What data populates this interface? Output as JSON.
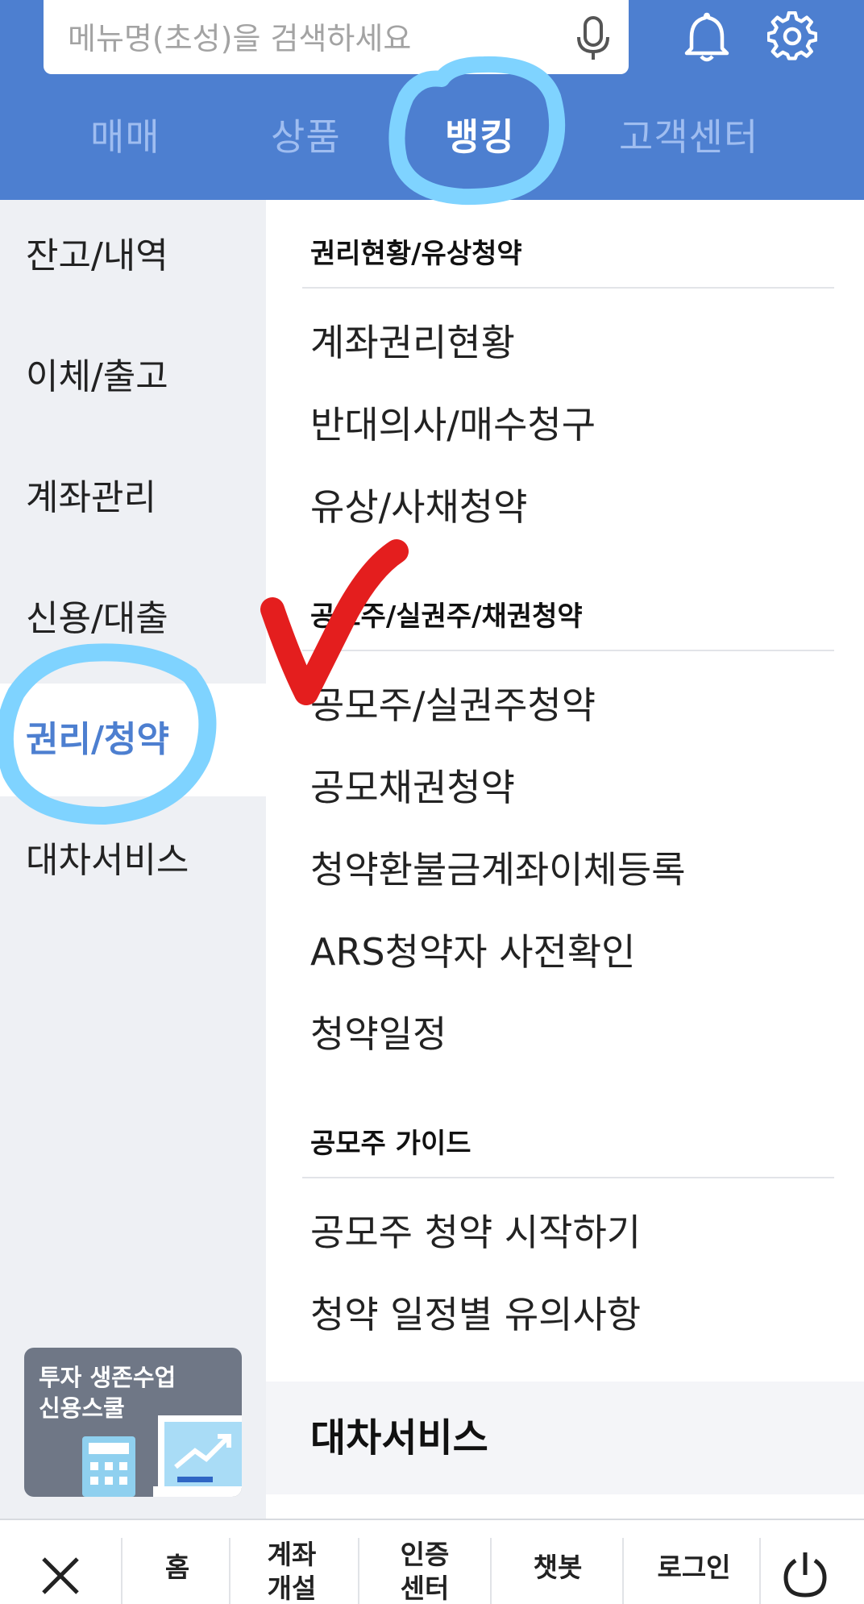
{
  "search": {
    "placeholder": "메뉴명(초성)을 검색하세요"
  },
  "header": {
    "icons": [
      "mic-icon",
      "bell-icon",
      "gear-icon"
    ]
  },
  "tabs": [
    {
      "label": "매매",
      "active": false
    },
    {
      "label": "상품",
      "active": false
    },
    {
      "label": "뱅킹",
      "active": true
    },
    {
      "label": "고객센터",
      "active": false
    }
  ],
  "sidebar": {
    "items": [
      {
        "label": "잔고/내역"
      },
      {
        "label": "이체/출고"
      },
      {
        "label": "계좌관리"
      },
      {
        "label": "신용/대출"
      },
      {
        "label": "권리/청약",
        "active": true
      },
      {
        "label": "대차서비스"
      }
    ],
    "promo": {
      "line1": "투자 생존수업",
      "line2": "신용스쿨"
    }
  },
  "content": {
    "sections": [
      {
        "title": "권리현황/유상청약",
        "links": [
          "계좌권리현황",
          "반대의사/매수청구",
          "유상/사채청약"
        ]
      },
      {
        "title": "공모주/실권주/채권청약",
        "links": [
          "공모주/실권주청약",
          "공모채권청약",
          "청약환불금계좌이체등록",
          "ARS청약자 사전확인",
          "청약일정"
        ]
      },
      {
        "title": "공모주 가이드",
        "links": [
          "공모주 청약 시작하기",
          "청약 일정별 유의사항"
        ]
      }
    ],
    "next_section": "대차서비스"
  },
  "bottom_nav": {
    "items": [
      {
        "label": "홈"
      },
      {
        "label": "계좌\n개설"
      },
      {
        "label": "인증\n센터"
      },
      {
        "label": "챗봇"
      },
      {
        "label": "로그인"
      }
    ]
  },
  "colors": {
    "brand_blue": "#4d7fd0",
    "annotation_circle": "#7fd3ff",
    "annotation_check": "#e41e1e"
  }
}
